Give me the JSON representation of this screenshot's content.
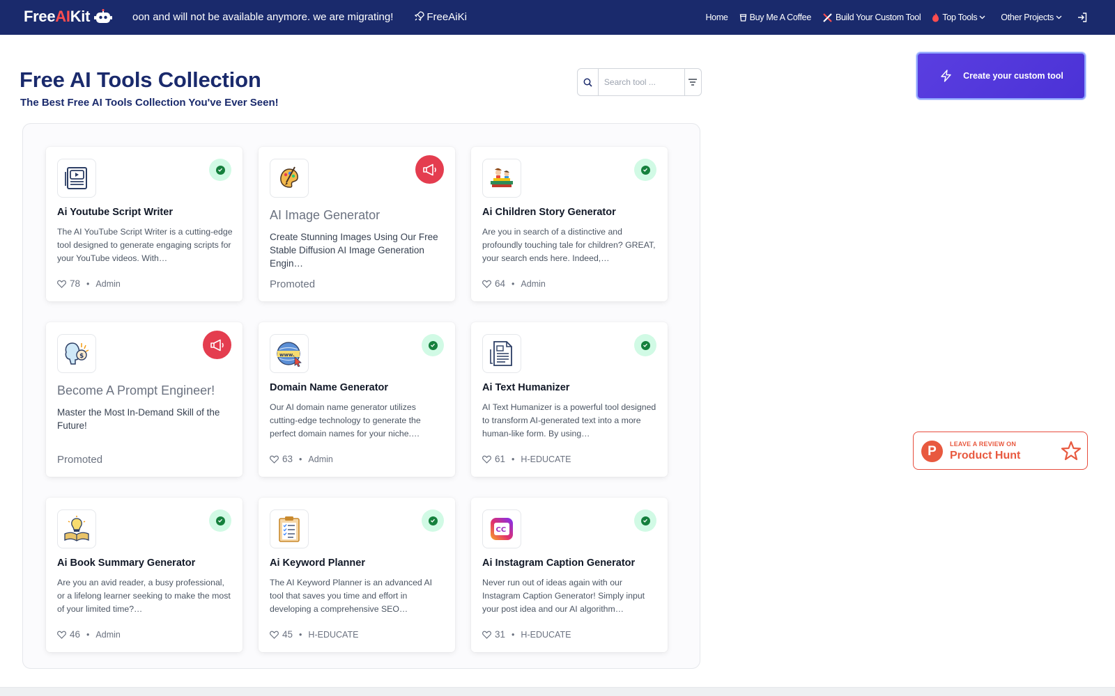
{
  "navbar": {
    "logo_free": "Free",
    "logo_ai": "AI",
    "logo_kit": "Kit",
    "marquee_text": "oon and will not be available anymore. we are migrating!",
    "marquee_text_2": "FreeAiKit i",
    "links": {
      "home": "Home",
      "coffee": "Buy Me A Coffee",
      "custom": "Build Your Custom Tool",
      "top_tools": "Top Tools",
      "other_projects": "Other Projects"
    }
  },
  "header": {
    "title": "Free AI Tools Collection",
    "subtitle": "The Best Free AI Tools Collection You've Ever Seen!"
  },
  "search": {
    "placeholder": "Search tool ..."
  },
  "cta": {
    "label": "Create your custom tool"
  },
  "product_hunt": {
    "small": "LEAVE A REVIEW ON",
    "big": "Product Hunt"
  },
  "cards": [
    {
      "title": "Ai Youtube Script Writer",
      "desc": "The AI YouTube Script Writer is a cutting-edge tool designed to generate engaging scripts for your YouTube videos. With…",
      "likes": "78",
      "author": "Admin",
      "icon": "video-script-icon"
    },
    {
      "title": "AI Image Generator",
      "desc": "Create Stunning Images Using Our Free Stable Diffusion AI Image Generation Engin…",
      "promo": "Promoted",
      "icon": "palette-icon"
    },
    {
      "title": "Ai Children Story Generator",
      "desc": "Are you in search of a distinctive and profoundly touching tale for children? GREAT, your search ends here. Indeed,…",
      "likes": "64",
      "author": "Admin",
      "icon": "kids-reading-icon"
    },
    {
      "title": "Become A Prompt Engineer!",
      "desc": "Master the Most In-Demand Skill of the Future!",
      "promo": "Promoted",
      "icon": "brain-dollar-icon"
    },
    {
      "title": "Domain Name Generator",
      "desc": "Our AI domain name generator utilizes cutting-edge technology to generate the perfect domain names for your niche.…",
      "likes": "63",
      "author": "Admin",
      "icon": "www-globe-icon"
    },
    {
      "title": "Ai Text Humanizer",
      "desc": "AI Text Humanizer is a powerful tool designed to transform AI-generated text into a more human-like form. By using…",
      "likes": "61",
      "author": "H-EDUCATE",
      "icon": "document-icon"
    },
    {
      "title": "Ai Book Summary Generator",
      "desc": "Are you an avid reader, a busy professional, or a lifelong learner seeking to make the most of your limited time?…",
      "likes": "46",
      "author": "Admin",
      "icon": "book-idea-icon"
    },
    {
      "title": "Ai Keyword Planner",
      "desc": "The AI Keyword Planner is an advanced AI tool that saves you time and effort in developing a comprehensive SEO…",
      "likes": "45",
      "author": "H-EDUCATE",
      "icon": "checklist-icon"
    },
    {
      "title": "Ai Instagram Caption Generator",
      "desc": "Never run out of ideas again with our Instagram Caption Generator! Simply input your post idea and our AI algorithm…",
      "likes": "31",
      "author": "H-EDUCATE",
      "icon": "cc-caption-icon"
    }
  ],
  "colors": {
    "navbar": "#1a2a6c",
    "accent": "#5a3ee0",
    "promo": "#e43d4f",
    "verified": "#15803d"
  }
}
